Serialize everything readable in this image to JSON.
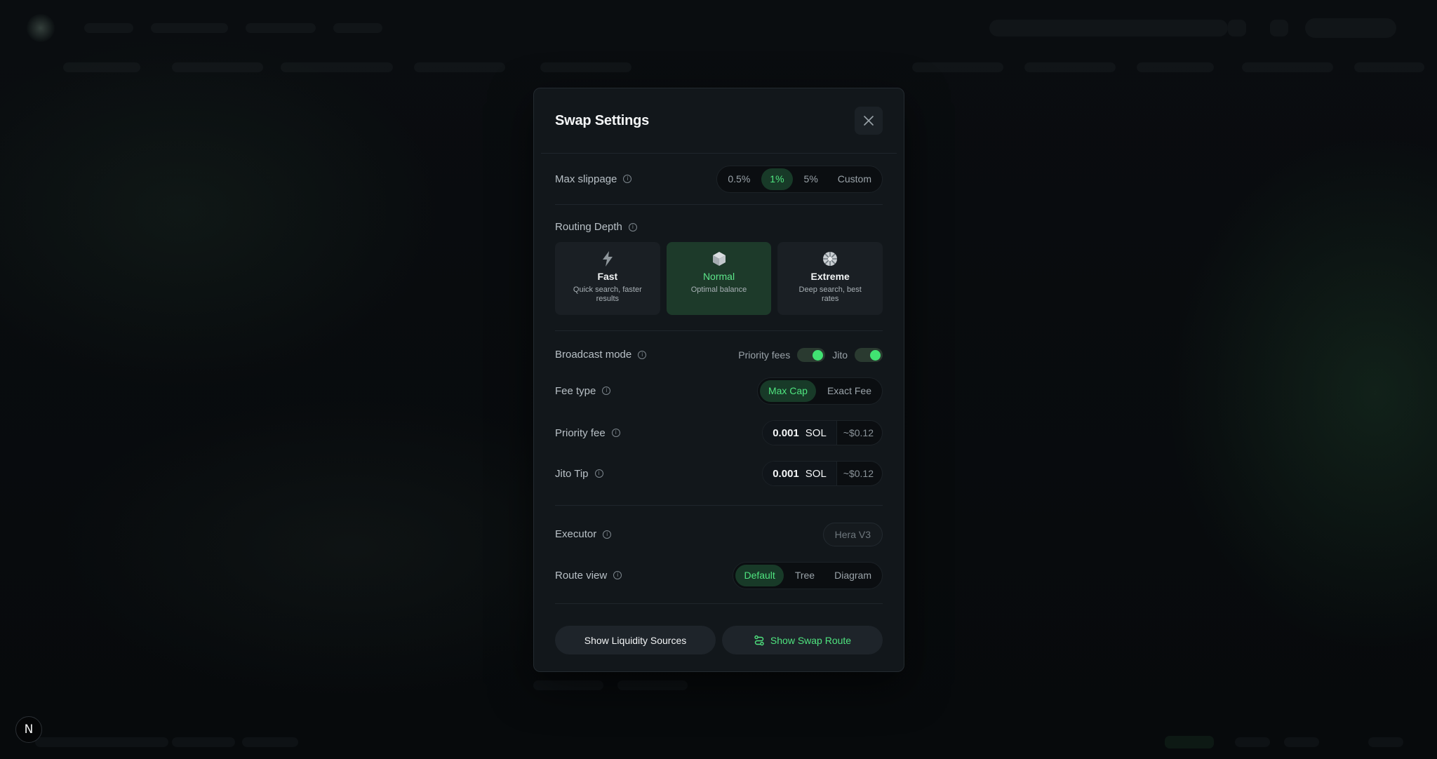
{
  "modal": {
    "title": "Swap Settings",
    "max_slippage": {
      "label": "Max slippage",
      "options": [
        "0.5%",
        "1%",
        "5%",
        "Custom"
      ],
      "selected": "1%"
    },
    "routing_depth": {
      "label": "Routing Depth",
      "options": [
        {
          "name": "Fast",
          "desc": "Quick search, faster results",
          "icon": "lightning-icon"
        },
        {
          "name": "Normal",
          "desc": "Optimal balance",
          "icon": "cube-icon"
        },
        {
          "name": "Extreme",
          "desc": "Deep search, best rates",
          "icon": "orb-icon"
        }
      ],
      "selected": "Normal"
    },
    "broadcast_mode": {
      "label": "Broadcast mode",
      "priority_fees_label": "Priority fees",
      "priority_fees_on": true,
      "jito_label": "Jito",
      "jito_on": true
    },
    "fee_type": {
      "label": "Fee type",
      "options": [
        "Max Cap",
        "Exact Fee"
      ],
      "selected": "Max Cap"
    },
    "priority_fee": {
      "label": "Priority fee",
      "value": "0.001",
      "unit": "SOL",
      "usd": "~$0.12"
    },
    "jito_tip": {
      "label": "Jito Tip",
      "value": "0.001",
      "unit": "SOL",
      "usd": "~$0.12"
    },
    "executor": {
      "label": "Executor",
      "value": "Hera V3"
    },
    "route_view": {
      "label": "Route view",
      "options": [
        "Default",
        "Tree",
        "Diagram"
      ],
      "selected": "Default"
    },
    "buttons": {
      "liquidity": "Show Liquidity Sources",
      "swap_route": "Show Swap Route"
    }
  },
  "badge": {
    "letter": "N"
  },
  "colors": {
    "accent": "#4fe47f",
    "active_bg": "#183a28",
    "modal_bg": "#12171b"
  }
}
